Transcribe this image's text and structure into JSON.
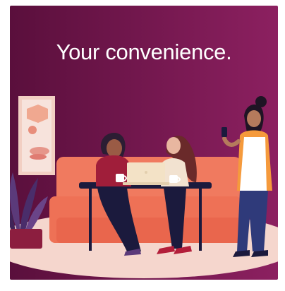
{
  "headline": "Your convenience.",
  "colors": {
    "background_left": "#5a0f3c",
    "background_right": "#8c2060",
    "floor": "#f5d6cd",
    "sofa": "#f07a5f",
    "table": "#1b1a3d",
    "laptop": "#f3e2c6",
    "frame": "#f2cfc3",
    "plant": "#5b3a7a",
    "apron": "#ffffff"
  },
  "icons": [
    "plant-icon",
    "wall-art-icon",
    "sofa-icon",
    "laptop-icon",
    "coffee-cup-icon",
    "phone-icon"
  ]
}
